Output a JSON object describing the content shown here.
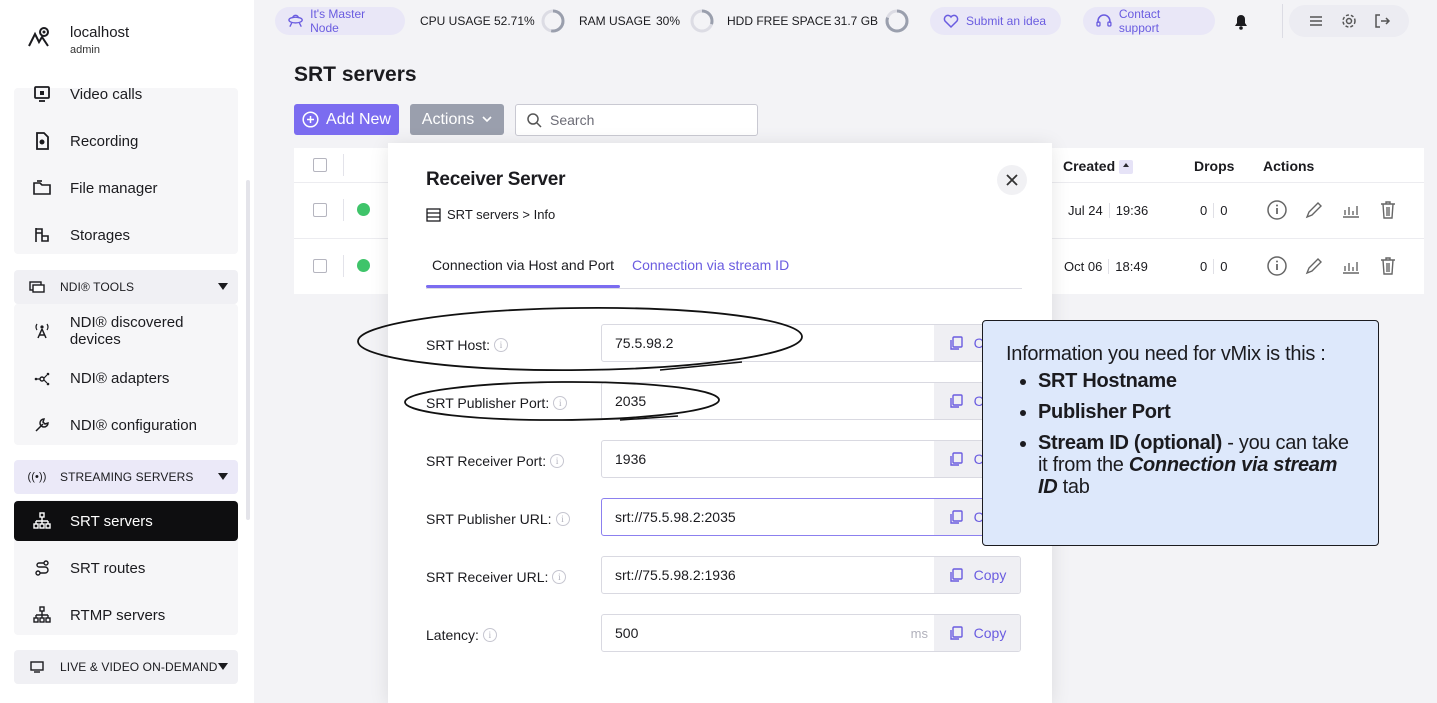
{
  "brand": {
    "host": "localhost",
    "user": "admin"
  },
  "sidebar": {
    "items_top": [
      {
        "label": "Video calls",
        "icon": "video-call-icon"
      },
      {
        "label": "Recording",
        "icon": "recording-icon"
      },
      {
        "label": "File manager",
        "icon": "folder-icon"
      },
      {
        "label": "Storages",
        "icon": "storage-icon"
      }
    ],
    "ndi_section": "NDI® TOOLS",
    "ndi_items": [
      {
        "label": "NDI® discovered devices",
        "icon": "ndi-devices-icon"
      },
      {
        "label": "NDI® adapters",
        "icon": "ndi-adapters-icon"
      },
      {
        "label": "NDI® configuration",
        "icon": "wrench-icon"
      }
    ],
    "streaming_section": "STREAMING SERVERS",
    "streaming_items": [
      {
        "label": "SRT servers",
        "icon": "network-icon",
        "active": true
      },
      {
        "label": "SRT routes",
        "icon": "route-icon"
      },
      {
        "label": "RTMP servers",
        "icon": "network-icon"
      }
    ],
    "live_section": "LIVE & VIDEO ON-DEMAND"
  },
  "topbar": {
    "master": "It's Master Node",
    "cpu_label": "CPU USAGE",
    "cpu_value": "52.71%",
    "cpu_fraction": 0.5271,
    "ram_label": "RAM USAGE",
    "ram_value": "30%",
    "ram_fraction": 0.3,
    "hdd_label": "HDD FREE SPACE",
    "hdd_value": "31.7 GB",
    "hdd_fraction": 0.8,
    "idea": "Submit an idea",
    "support": "Contact support"
  },
  "page": {
    "title": "SRT servers",
    "add_label": "Add New",
    "actions_label": "Actions",
    "search_placeholder": "Search"
  },
  "table": {
    "headers": {
      "created": "Created",
      "drops": "Drops",
      "actions": "Actions"
    },
    "rows": [
      {
        "date": "Jul 24",
        "time": "19:36",
        "drops_a": "0",
        "drops_b": "0",
        "status": "online"
      },
      {
        "date": "Oct 06",
        "time": "18:49",
        "drops_a": "0",
        "drops_b": "0",
        "status": "online"
      }
    ]
  },
  "modal": {
    "title": "Receiver Server",
    "breadcrumb": "SRT servers > Info",
    "tabs": [
      "Connection via Host and Port",
      "Connection via stream ID"
    ],
    "copy_label": "Copy",
    "fields": [
      {
        "label": "SRT Host:",
        "value": "75.5.98.2"
      },
      {
        "label": "SRT Publisher Port:",
        "value": "2035"
      },
      {
        "label": "SRT Receiver Port:",
        "value": "1936"
      },
      {
        "label": "SRT Publisher URL:",
        "value": "srt://75.5.98.2:2035"
      },
      {
        "label": "SRT Receiver URL:",
        "value": "srt://75.5.98.2:1936"
      },
      {
        "label": "Latency:",
        "value": "500",
        "unit": "ms"
      }
    ]
  },
  "callout": {
    "intro": "Information you need for vMix is this :",
    "item1": "SRT Hostname",
    "item2": "Publisher Port",
    "item3_bold": "Stream ID (optional)",
    "item3_rest": " - you can take it from the ",
    "item3_em": "Connection via stream ID",
    "item3_end": " tab"
  },
  "colors": {
    "accent": "#7b6cf0",
    "active_nav": "#0e0e10",
    "online": "#3fc46a",
    "callout_bg": "#dde8fb"
  }
}
